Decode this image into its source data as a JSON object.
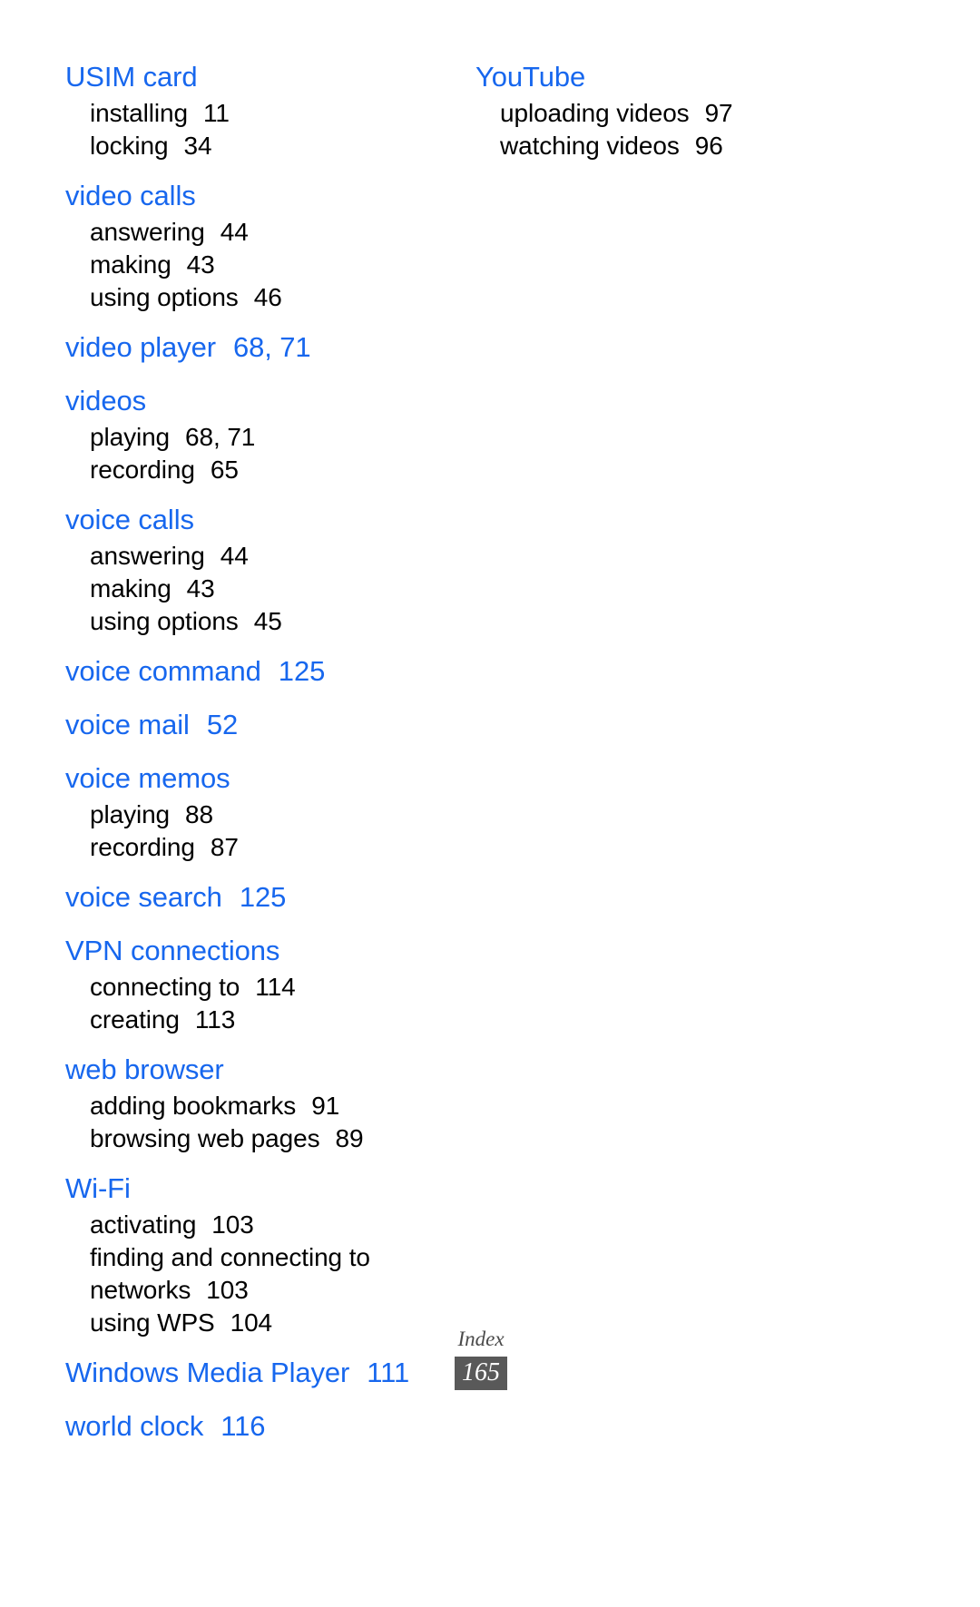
{
  "document": {
    "kind": "index-page",
    "accent_color": "#1767ee",
    "text_color": "#000000",
    "background_color": "#ffffff",
    "footer_badge_color": "#595959"
  },
  "columns": {
    "left": [
      {
        "heading": "USIM card",
        "heading_pages": "",
        "entries": [
          {
            "label": "installing",
            "pages": "11"
          },
          {
            "label": "locking",
            "pages": "34"
          }
        ]
      },
      {
        "heading": "video calls",
        "heading_pages": "",
        "entries": [
          {
            "label": "answering",
            "pages": "44"
          },
          {
            "label": "making",
            "pages": "43"
          },
          {
            "label": "using options",
            "pages": "46"
          }
        ]
      },
      {
        "heading": "video player",
        "heading_pages": "68, 71",
        "entries": []
      },
      {
        "heading": "videos",
        "heading_pages": "",
        "entries": [
          {
            "label": "playing",
            "pages": "68, 71"
          },
          {
            "label": "recording",
            "pages": "65"
          }
        ]
      },
      {
        "heading": "voice calls",
        "heading_pages": "",
        "entries": [
          {
            "label": "answering",
            "pages": "44"
          },
          {
            "label": "making",
            "pages": "43"
          },
          {
            "label": "using options",
            "pages": "45"
          }
        ]
      },
      {
        "heading": "voice command",
        "heading_pages": "125",
        "entries": []
      },
      {
        "heading": "voice mail",
        "heading_pages": "52",
        "entries": []
      },
      {
        "heading": "voice memos",
        "heading_pages": "",
        "entries": [
          {
            "label": "playing",
            "pages": "88"
          },
          {
            "label": "recording",
            "pages": "87"
          }
        ]
      },
      {
        "heading": "voice search",
        "heading_pages": "125",
        "entries": []
      },
      {
        "heading": "VPN connections",
        "heading_pages": "",
        "entries": [
          {
            "label": "connecting to",
            "pages": "114"
          },
          {
            "label": "creating",
            "pages": "113"
          }
        ]
      },
      {
        "heading": "web browser",
        "heading_pages": "",
        "entries": [
          {
            "label": "adding bookmarks",
            "pages": "91"
          },
          {
            "label": "browsing web pages",
            "pages": "89"
          }
        ]
      },
      {
        "heading": "Wi-Fi",
        "heading_pages": "",
        "entries": [
          {
            "label": "activating",
            "pages": "103"
          },
          {
            "label": "finding and connecting to networks",
            "pages": "103",
            "wraps": true
          },
          {
            "label": "using WPS",
            "pages": "104"
          }
        ]
      },
      {
        "heading": "Windows Media Player",
        "heading_pages": "111",
        "entries": []
      },
      {
        "heading": "world clock",
        "heading_pages": "116",
        "entries": []
      }
    ],
    "right": [
      {
        "heading": "YouTube",
        "heading_pages": "",
        "entries": [
          {
            "label": "uploading videos",
            "pages": "97"
          },
          {
            "label": "watching videos",
            "pages": "96"
          }
        ]
      }
    ]
  },
  "footer": {
    "label": "Index",
    "page_number": "165"
  }
}
